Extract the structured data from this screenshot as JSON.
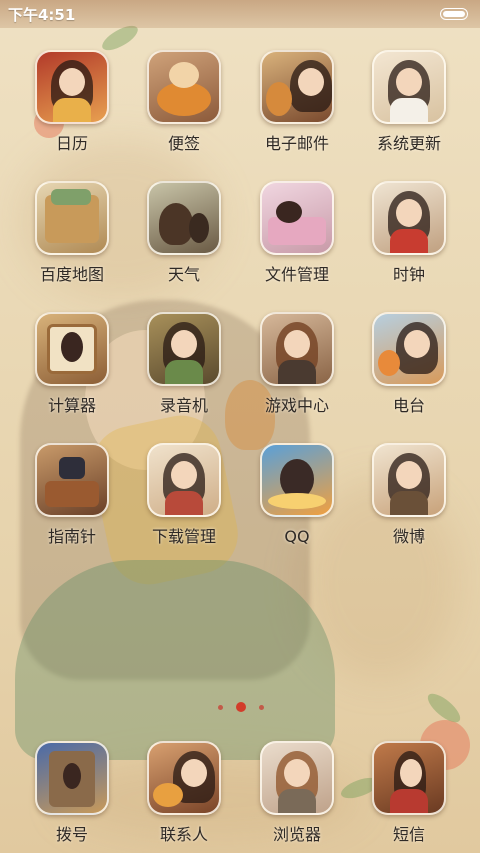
{
  "status_bar": {
    "time": "下午4:51"
  },
  "colors": {
    "tile_border": "#fffaf0",
    "label": "#2f2a26",
    "status_tint": "#aa7850",
    "page_dot": "#d23c2a"
  },
  "apps": [
    {
      "label": "日历",
      "icon": "calendar-art-icon"
    },
    {
      "label": "便签",
      "icon": "notes-art-icon"
    },
    {
      "label": "电子邮件",
      "icon": "email-art-icon"
    },
    {
      "label": "系统更新",
      "icon": "update-art-icon"
    },
    {
      "label": "百度地图",
      "icon": "map-art-icon"
    },
    {
      "label": "天气",
      "icon": "weather-art-icon"
    },
    {
      "label": "文件管理",
      "icon": "files-art-icon"
    },
    {
      "label": "时钟",
      "icon": "clock-art-icon"
    },
    {
      "label": "计算器",
      "icon": "calculator-art-icon"
    },
    {
      "label": "录音机",
      "icon": "recorder-art-icon"
    },
    {
      "label": "游戏中心",
      "icon": "game-center-art-icon"
    },
    {
      "label": "电台",
      "icon": "radio-art-icon"
    },
    {
      "label": "指南针",
      "icon": "compass-art-icon"
    },
    {
      "label": "下载管理",
      "icon": "downloads-art-icon"
    },
    {
      "label": "QQ",
      "icon": "qq-art-icon"
    },
    {
      "label": "微博",
      "icon": "weibo-art-icon"
    }
  ],
  "dock": [
    {
      "label": "拨号",
      "icon": "dialer-art-icon"
    },
    {
      "label": "联系人",
      "icon": "contacts-art-icon"
    },
    {
      "label": "浏览器",
      "icon": "browser-art-icon"
    },
    {
      "label": "短信",
      "icon": "sms-art-icon"
    }
  ],
  "page_indicator": {
    "pages": 3,
    "current": 2
  }
}
